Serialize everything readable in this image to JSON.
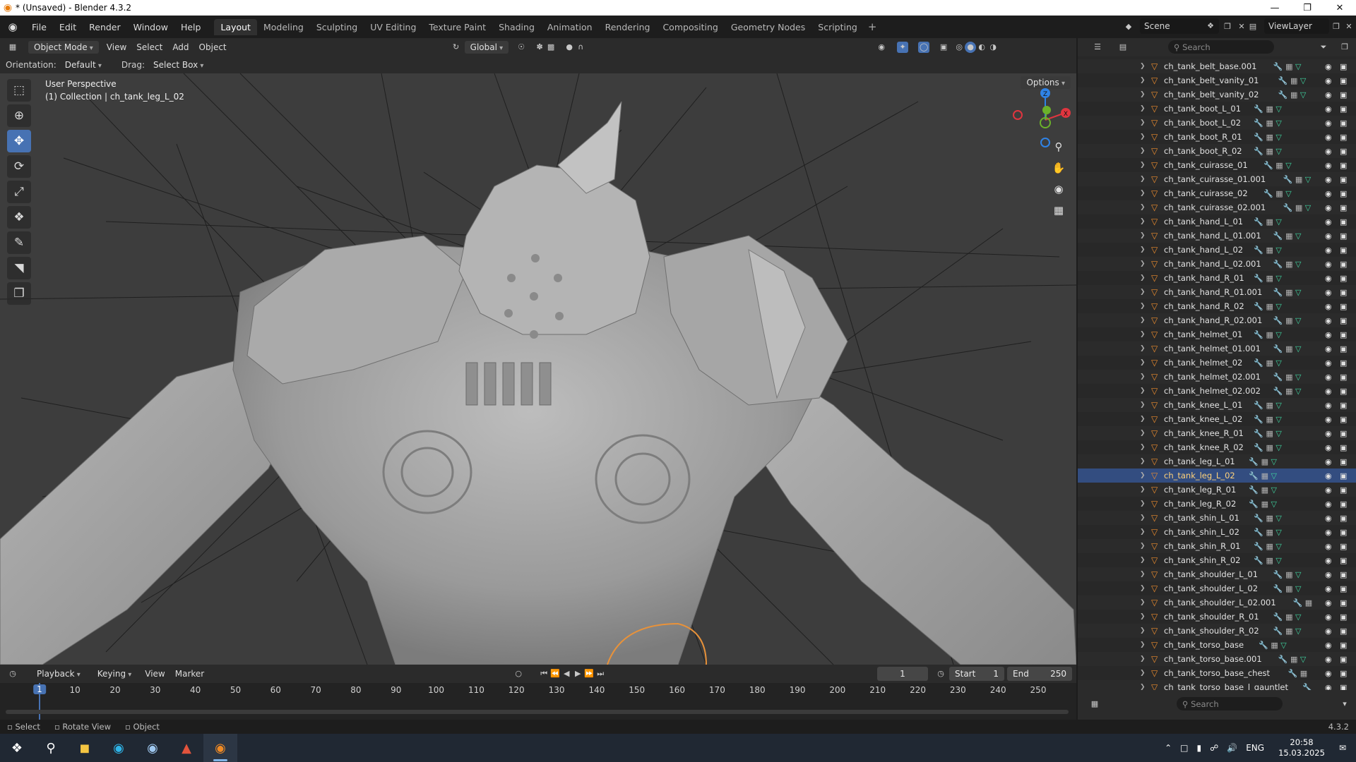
{
  "window": {
    "title": "* (Unsaved) - Blender 4.3.2",
    "controls": [
      "—",
      "❐",
      "✕"
    ]
  },
  "menu": [
    "File",
    "Edit",
    "Render",
    "Window",
    "Help"
  ],
  "workspaces": {
    "tabs": [
      "Layout",
      "Modeling",
      "Sculpting",
      "UV Editing",
      "Texture Paint",
      "Shading",
      "Animation",
      "Rendering",
      "Compositing",
      "Geometry Nodes",
      "Scripting"
    ],
    "active": "Layout"
  },
  "scene": {
    "name": "Scene"
  },
  "view_layer": {
    "name": "ViewLayer"
  },
  "viewport": {
    "mode": "Object Mode",
    "menus": [
      "View",
      "Select",
      "Add",
      "Object"
    ],
    "transform_orientation": "Global",
    "orientation_label": "Orientation:",
    "orientation_value": "Default",
    "drag_label": "Drag:",
    "drag_value": "Select Box",
    "options_label": "Options",
    "perspective": "User Perspective",
    "collection_info": "(1) Collection | ch_tank_leg_L_02",
    "gizmo": {
      "x": "X",
      "y": "Y",
      "z": "Z",
      "x_color": "#e0353f",
      "y_color": "#6bb22a",
      "z_color": "#2f83e6"
    }
  },
  "timeline": {
    "menus": [
      "Playback",
      "Keying",
      "View",
      "Marker"
    ],
    "current_frame": "1",
    "start_label": "Start",
    "start": "1",
    "end_label": "End",
    "end": "250",
    "ticks": [
      "1",
      "10",
      "20",
      "30",
      "40",
      "50",
      "60",
      "70",
      "80",
      "90",
      "100",
      "110",
      "120",
      "130",
      "140",
      "150",
      "160",
      "170",
      "180",
      "190",
      "200",
      "210",
      "220",
      "230",
      "240",
      "250"
    ]
  },
  "statusbar": {
    "items": [
      "Select",
      "Rotate View",
      "Object"
    ],
    "version": "4.3.2"
  },
  "outliner": {
    "search_placeholder": "Search",
    "selected": "ch_tank_leg_L_02",
    "items": [
      {
        "name": "ch_tank_belt_base.001",
        "mods": [
          "wrench",
          "modifier",
          "vertex"
        ]
      },
      {
        "name": "ch_tank_belt_vanity_01",
        "mods": [
          "wrench",
          "modifier",
          "vertex"
        ]
      },
      {
        "name": "ch_tank_belt_vanity_02",
        "mods": [
          "wrench",
          "modifier",
          "vertex"
        ]
      },
      {
        "name": "ch_tank_boot_L_01",
        "mods": [
          "wrench",
          "modifier",
          "vertex"
        ]
      },
      {
        "name": "ch_tank_boot_L_02",
        "mods": [
          "wrench",
          "modifier",
          "vertex"
        ]
      },
      {
        "name": "ch_tank_boot_R_01",
        "mods": [
          "wrench",
          "modifier",
          "vertex"
        ]
      },
      {
        "name": "ch_tank_boot_R_02",
        "mods": [
          "wrench",
          "modifier",
          "vertex"
        ]
      },
      {
        "name": "ch_tank_cuirasse_01",
        "mods": [
          "wrench",
          "modifier",
          "vertex"
        ]
      },
      {
        "name": "ch_tank_cuirasse_01.001",
        "mods": [
          "wrench",
          "modifier",
          "vertex"
        ]
      },
      {
        "name": "ch_tank_cuirasse_02",
        "mods": [
          "wrench",
          "modifier",
          "vertex"
        ]
      },
      {
        "name": "ch_tank_cuirasse_02.001",
        "mods": [
          "wrench",
          "modifier",
          "vertex"
        ]
      },
      {
        "name": "ch_tank_hand_L_01",
        "mods": [
          "wrench",
          "modifier",
          "vertex"
        ]
      },
      {
        "name": "ch_tank_hand_L_01.001",
        "mods": [
          "wrench",
          "modifier",
          "vertex"
        ]
      },
      {
        "name": "ch_tank_hand_L_02",
        "mods": [
          "wrench",
          "modifier",
          "vertex"
        ]
      },
      {
        "name": "ch_tank_hand_L_02.001",
        "mods": [
          "wrench",
          "modifier",
          "vertex"
        ]
      },
      {
        "name": "ch_tank_hand_R_01",
        "mods": [
          "wrench",
          "modifier",
          "vertex"
        ]
      },
      {
        "name": "ch_tank_hand_R_01.001",
        "mods": [
          "wrench",
          "modifier",
          "vertex"
        ]
      },
      {
        "name": "ch_tank_hand_R_02",
        "mods": [
          "wrench",
          "modifier",
          "vertex"
        ]
      },
      {
        "name": "ch_tank_hand_R_02.001",
        "mods": [
          "wrench",
          "modifier",
          "vertex"
        ]
      },
      {
        "name": "ch_tank_helmet_01",
        "mods": [
          "wrench",
          "modifier",
          "vertex"
        ]
      },
      {
        "name": "ch_tank_helmet_01.001",
        "mods": [
          "wrench",
          "modifier",
          "vertex"
        ]
      },
      {
        "name": "ch_tank_helmet_02",
        "mods": [
          "wrench",
          "modifier",
          "vertex"
        ]
      },
      {
        "name": "ch_tank_helmet_02.001",
        "mods": [
          "wrench",
          "modifier",
          "vertex"
        ]
      },
      {
        "name": "ch_tank_helmet_02.002",
        "mods": [
          "wrench",
          "modifier",
          "vertex"
        ]
      },
      {
        "name": "ch_tank_knee_L_01",
        "mods": [
          "wrench",
          "modifier",
          "vertex"
        ]
      },
      {
        "name": "ch_tank_knee_L_02",
        "mods": [
          "wrench",
          "modifier",
          "vertex"
        ]
      },
      {
        "name": "ch_tank_knee_R_01",
        "mods": [
          "wrench",
          "modifier",
          "vertex"
        ]
      },
      {
        "name": "ch_tank_knee_R_02",
        "mods": [
          "wrench",
          "modifier",
          "vertex"
        ]
      },
      {
        "name": "ch_tank_leg_L_01",
        "mods": [
          "wrench",
          "modifier",
          "vertex"
        ]
      },
      {
        "name": "ch_tank_leg_L_02",
        "mods": [
          "wrench",
          "modifier",
          "vertex"
        ]
      },
      {
        "name": "ch_tank_leg_R_01",
        "mods": [
          "wrench",
          "modifier",
          "vertex"
        ]
      },
      {
        "name": "ch_tank_leg_R_02",
        "mods": [
          "wrench",
          "modifier",
          "vertex"
        ]
      },
      {
        "name": "ch_tank_shin_L_01",
        "mods": [
          "wrench",
          "modifier",
          "vertex"
        ]
      },
      {
        "name": "ch_tank_shin_L_02",
        "mods": [
          "wrench",
          "modifier",
          "vertex"
        ]
      },
      {
        "name": "ch_tank_shin_R_01",
        "mods": [
          "wrench",
          "modifier",
          "vertex"
        ]
      },
      {
        "name": "ch_tank_shin_R_02",
        "mods": [
          "wrench",
          "modifier",
          "vertex"
        ]
      },
      {
        "name": "ch_tank_shoulder_L_01",
        "mods": [
          "wrench",
          "modifier",
          "vertex"
        ]
      },
      {
        "name": "ch_tank_shoulder_L_02",
        "mods": [
          "wrench",
          "modifier",
          "vertex"
        ]
      },
      {
        "name": "ch_tank_shoulder_L_02.001",
        "mods": [
          "wrench",
          "modifier"
        ]
      },
      {
        "name": "ch_tank_shoulder_R_01",
        "mods": [
          "wrench",
          "modifier",
          "vertex"
        ]
      },
      {
        "name": "ch_tank_shoulder_R_02",
        "mods": [
          "wrench",
          "modifier",
          "vertex"
        ]
      },
      {
        "name": "ch_tank_torso_base",
        "mods": [
          "wrench",
          "modifier",
          "vertex"
        ]
      },
      {
        "name": "ch_tank_torso_base.001",
        "mods": [
          "wrench",
          "modifier",
          "vertex"
        ]
      },
      {
        "name": "ch_tank_torso_base_chest",
        "mods": [
          "wrench",
          "modifier"
        ]
      },
      {
        "name": "ch_tank_torso_base_l_gauntlet",
        "mods": [
          "wrench"
        ]
      }
    ]
  },
  "properties": {
    "search_placeholder": "Search"
  },
  "taskbar": {
    "apps": [
      "windows-start",
      "search",
      "file-explorer",
      "edge",
      "steam",
      "media-app",
      "blender"
    ],
    "language": "ENG",
    "time": "20:58",
    "date": "15.03.2025"
  },
  "colors": {
    "accent": "#4772b3",
    "selection_row": "#334d80",
    "object_orange": "#ee8d2e"
  }
}
